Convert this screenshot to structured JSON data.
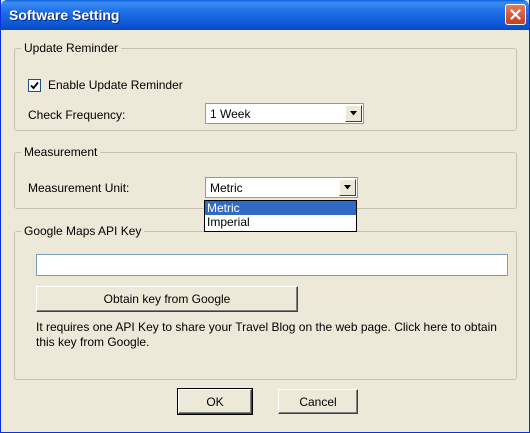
{
  "window": {
    "title": "Software Setting",
    "close_icon": "close-x-icon"
  },
  "update_reminder": {
    "legend": "Update Reminder",
    "enable_label": "Enable Update Reminder",
    "enable_checked": true,
    "frequency_label": "Check Frequency:",
    "frequency_value": "1 Week"
  },
  "measurement": {
    "legend": "Measurement",
    "unit_label": "Measurement Unit:",
    "unit_value": "Metric",
    "options": [
      "Metric",
      "Imperial"
    ],
    "selected_option": "Metric"
  },
  "google": {
    "legend": "Google Maps API Key",
    "api_key_value": "",
    "obtain_button": "Obtain key from Google",
    "description": "It requires one API Key to share your Travel Blog on the web page. Click here to obtain this key from Google."
  },
  "footer": {
    "ok_label": "OK",
    "cancel_label": "Cancel"
  },
  "colors": {
    "titlebar": "#0a5fd8",
    "dialog_bg": "#ece9d8",
    "selection": "#316ac5",
    "close_button": "#c93d1b"
  }
}
